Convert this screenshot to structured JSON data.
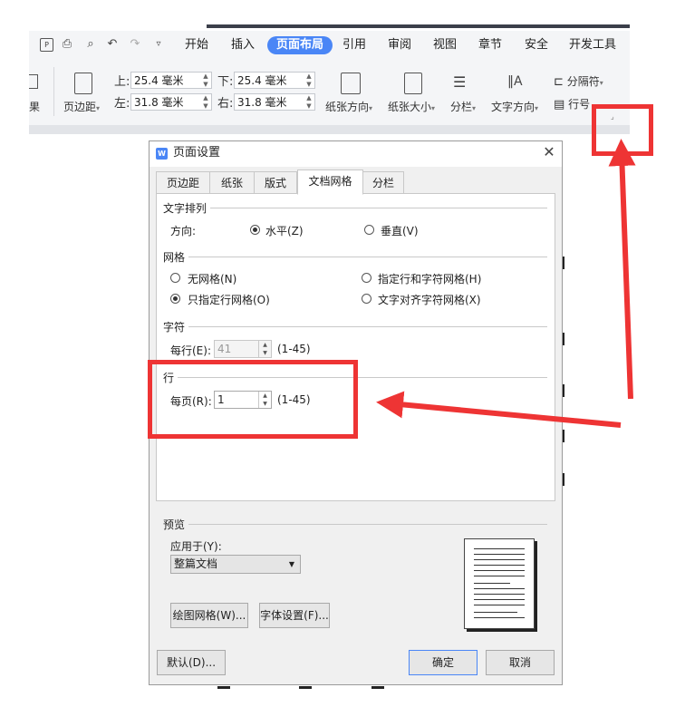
{
  "toolbar": {
    "tabs": [
      "开始",
      "插入",
      "页面布局",
      "引用",
      "审阅",
      "视图",
      "章节",
      "安全",
      "开发工具"
    ],
    "active_tab": "页面布局",
    "quick_icons": [
      "pdf-icon",
      "print-icon",
      "print-preview-icon",
      "undo-icon",
      "redo-icon",
      "more-icon"
    ],
    "margins_label": "页边距",
    "margins": {
      "top_label": "上:",
      "top_value": "25.4 毫米",
      "bottom_label": "下:",
      "bottom_value": "25.4 毫米",
      "left_label": "左:",
      "left_value": "31.8 毫米",
      "right_label": "右:",
      "right_value": "31.8 毫米"
    },
    "orientation_label": "纸张方向",
    "size_label": "纸张大小",
    "columns_label": "分栏",
    "text_direction_label": "文字方向",
    "break_label": "分隔符",
    "line_number_label": "行号",
    "left_cut_label": "果"
  },
  "dialog": {
    "title": "页面设置",
    "logo_text": "W",
    "close": "✕",
    "tabs": [
      "页边距",
      "纸张",
      "版式",
      "文档网格",
      "分栏"
    ],
    "active_tab": "文档网格",
    "text_arrange": {
      "section": "文字排列",
      "direction_label": "方向:",
      "horizontal": "水平(Z)",
      "vertical": "垂直(V)",
      "selected": "水平(Z)"
    },
    "grid": {
      "section": "网格",
      "options": [
        "无网格(N)",
        "指定行和字符网格(H)",
        "只指定行网格(O)",
        "文字对齐字符网格(X)"
      ],
      "selected": "只指定行网格(O)"
    },
    "chars": {
      "section": "字符",
      "per_line_label": "每行(E):",
      "per_line_value": "41",
      "range": "(1-45)"
    },
    "lines": {
      "section": "行",
      "per_page_label": "每页(R):",
      "per_page_value": "1",
      "range": "(1-45)"
    },
    "preview": {
      "section": "预览",
      "apply_to_label": "应用于(Y):",
      "apply_to_value": "整篇文档"
    },
    "buttons": {
      "draw_grid": "绘图网格(W)...",
      "font_settings": "字体设置(F)...",
      "default": "默认(D)...",
      "ok": "确定",
      "cancel": "取消"
    }
  },
  "colors": {
    "accent": "#4a86f6",
    "annotation": "#ee3434"
  }
}
